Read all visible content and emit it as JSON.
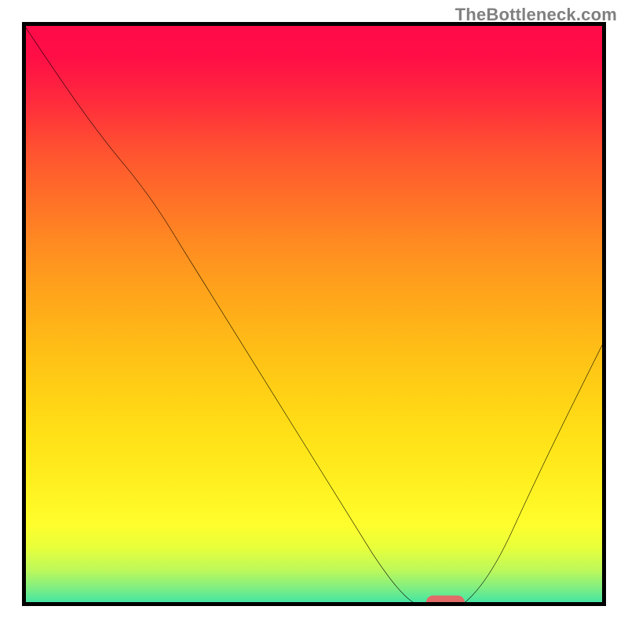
{
  "watermark": "TheBottleneck.com",
  "colors": {
    "frame": "#000000",
    "curve": "#000000",
    "marker_fill": "#e26a67",
    "marker_stroke": "#e26a67"
  },
  "chart_data": {
    "type": "line",
    "title": "",
    "xlabel": "",
    "ylabel": "",
    "xlim": [
      0,
      100
    ],
    "ylim": [
      0,
      100
    ],
    "grid": false,
    "legend": false,
    "series": [
      {
        "name": "bottleneck-curve",
        "x": [
          0,
          5,
          10,
          15,
          18,
          20,
          25,
          30,
          35,
          40,
          45,
          50,
          55,
          60,
          64,
          68,
          72,
          75,
          80,
          85,
          90,
          95,
          100
        ],
        "y": [
          100,
          93,
          86,
          79,
          75,
          72,
          64,
          56,
          48,
          40,
          32,
          24,
          16,
          9,
          4,
          1,
          0,
          0,
          3,
          10,
          20,
          32,
          46
        ]
      }
    ],
    "marker": {
      "name": "optimal-range",
      "shape": "pill",
      "x_center": 72.5,
      "x_half_width": 3.2,
      "y": 0
    },
    "description": "A V-shaped curve on a vertical rainbow gradient (red at top through orange/yellow to green at bottom). The curve starts at the top-left corner, descends with a slight knee around x≈18, reaches the bottom near x≈68–75, then rises to roughly half height by the right edge. A small salmon pill marks the minimum on the x-axis."
  }
}
